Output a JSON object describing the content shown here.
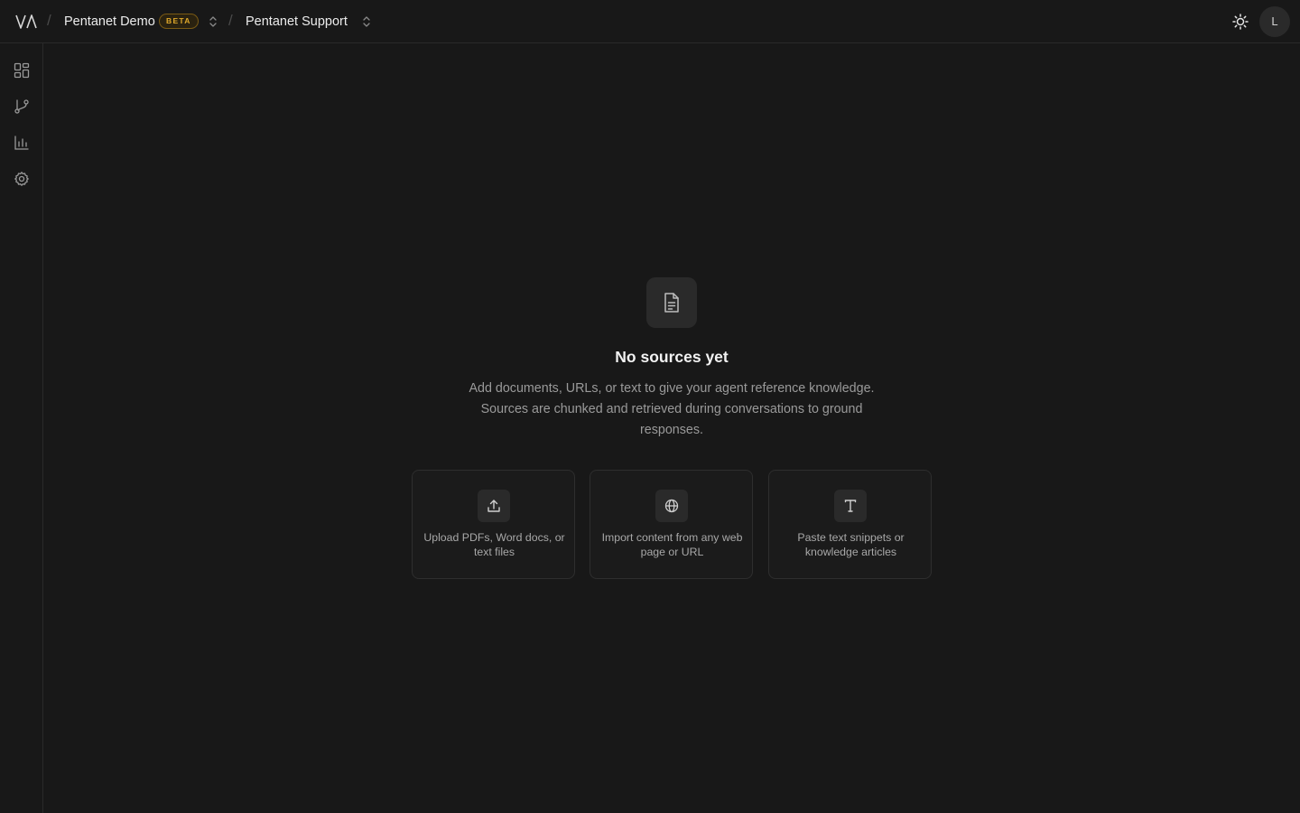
{
  "header": {
    "org_name": "Pentanet Demo",
    "org_badge": "BETA",
    "project_name": "Pentanet Support",
    "avatar_initial": "L"
  },
  "sidebar": {
    "items": [
      {
        "icon": "dashboard-icon"
      },
      {
        "icon": "flow-branch-icon"
      },
      {
        "icon": "analytics-chart-icon"
      },
      {
        "icon": "settings-gear-icon"
      }
    ]
  },
  "empty_state": {
    "icon": "document-icon",
    "title": "No sources yet",
    "description": "Add documents, URLs, or text to give your agent reference knowledge. Sources are chunked and retrieved during conversations to ground responses."
  },
  "source_options": [
    {
      "icon": "upload-icon",
      "label": "Upload PDFs, Word docs, or text files"
    },
    {
      "icon": "globe-icon",
      "label": "Import content from any web page or URL"
    },
    {
      "icon": "text-icon",
      "label": "Paste text snippets or knowledge articles"
    }
  ],
  "colors": {
    "background": "#181818",
    "border": "#2a2a2a",
    "badge_accent": "#e0a92b"
  }
}
